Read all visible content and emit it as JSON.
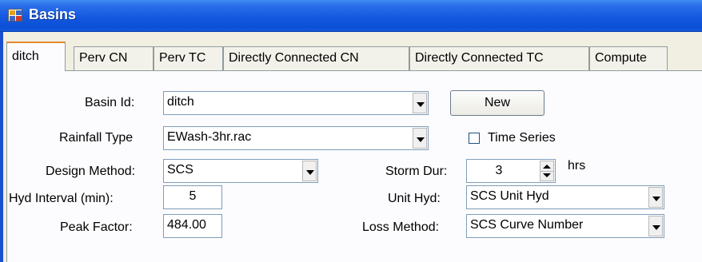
{
  "window": {
    "title": "Basins",
    "icon": "app-grid-icon"
  },
  "tabs": [
    {
      "label": "ditch",
      "active": true
    },
    {
      "label": "Perv CN"
    },
    {
      "label": "Perv TC"
    },
    {
      "label": "Directly Connected CN"
    },
    {
      "label": "Directly Connected TC"
    },
    {
      "label": "Compute"
    }
  ],
  "form": {
    "basin_id": {
      "label": "Basin Id:",
      "value": "ditch"
    },
    "new_button": "New",
    "rainfall_type": {
      "label": "Rainfall Type",
      "value": "EWash-3hr.rac"
    },
    "time_series": {
      "label": "Time Series",
      "checked": false
    },
    "design_method": {
      "label": "Design Method:",
      "value": "SCS"
    },
    "storm_dur": {
      "label": "Storm Dur:",
      "value": "3",
      "unit": "hrs"
    },
    "hyd_interval": {
      "label": "Hyd Interval (min):",
      "value": "5"
    },
    "unit_hyd": {
      "label": "Unit Hyd:",
      "value": "SCS Unit Hyd"
    },
    "peak_factor": {
      "label": "Peak Factor:",
      "value": "484.00"
    },
    "loss_method": {
      "label": "Loss Method:",
      "value": "SCS Curve Number"
    }
  }
}
